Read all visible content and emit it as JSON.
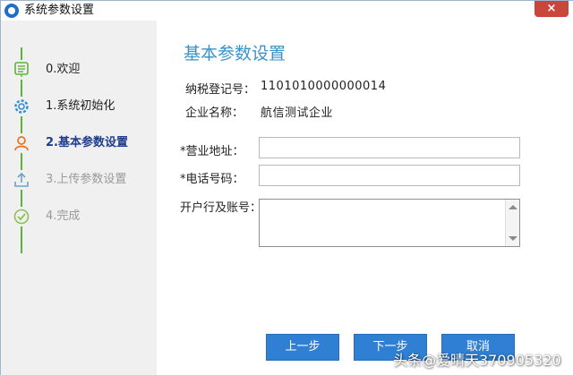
{
  "window": {
    "title": "系统参数设置",
    "close_label": "×"
  },
  "sidebar": {
    "steps": [
      {
        "label": "0.欢迎",
        "icon": "list-icon",
        "state": "done"
      },
      {
        "label": "1.系统初始化",
        "icon": "gear-icon",
        "state": "done"
      },
      {
        "label": "2.基本参数设置",
        "icon": "user-icon",
        "state": "active"
      },
      {
        "label": "3.上传参数设置",
        "icon": "upload-icon",
        "state": "disabled"
      },
      {
        "label": "4.完成",
        "icon": "check-circle-icon",
        "state": "disabled"
      }
    ],
    "track_color": "#5db33c"
  },
  "main": {
    "heading": "基本参数设置",
    "tax_id_label": "纳税登记号：",
    "tax_id_value": "1101010000000014",
    "company_label": "企业名称：",
    "company_value": "航信测试企业",
    "address_label": "*营业地址：",
    "address_value": "",
    "phone_label": "*电话号码：",
    "phone_value": "",
    "bank_label": "开户行及账号：",
    "bank_value": ""
  },
  "buttons": {
    "prev": "上一步",
    "next": "下一步",
    "cancel": "取消"
  },
  "watermark": "头条@爱晴天370905320",
  "colors": {
    "accent": "#2f80d4",
    "heading": "#3a93c8",
    "active_step": "#1f3d8c",
    "close": "#c9463d"
  }
}
